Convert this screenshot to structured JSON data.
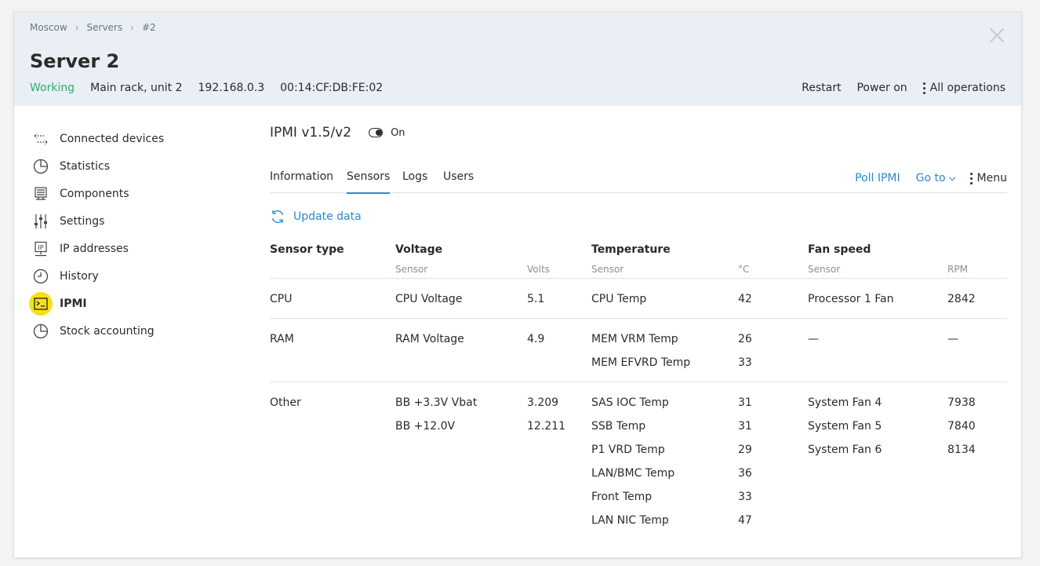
{
  "breadcrumb": [
    "Moscow",
    "Servers",
    "#2"
  ],
  "title": "Server 2",
  "meta": {
    "status": "Working",
    "location": "Main rack, unit 2",
    "ip": "192.168.0.3",
    "mac": "00:14:CF:DB:FE:02"
  },
  "header_actions": {
    "restart": "Restart",
    "power_on": "Power on",
    "all_operations": "All operations"
  },
  "sidebar": {
    "items": [
      {
        "label": "Connected devices",
        "icon": "connected-devices-icon"
      },
      {
        "label": "Statistics",
        "icon": "pie-chart-icon"
      },
      {
        "label": "Components",
        "icon": "components-icon"
      },
      {
        "label": "Settings",
        "icon": "sliders-icon"
      },
      {
        "label": "IP addresses",
        "icon": "ip-icon"
      },
      {
        "label": "History",
        "icon": "clock-icon"
      },
      {
        "label": "IPMI",
        "icon": "terminal-icon",
        "active": true
      },
      {
        "label": "Stock accounting",
        "icon": "pie-chart-icon"
      }
    ]
  },
  "ipmi": {
    "title": "IPMI v1.5/v2",
    "toggle_label": "On",
    "tabs": [
      "Information",
      "Sensors",
      "Logs",
      "Users"
    ],
    "active_tab": "Sensors",
    "poll": "Poll IPMI",
    "goto": "Go to",
    "menu": "Menu",
    "update": "Update data"
  },
  "table": {
    "headers": {
      "sensor_type": "Sensor type",
      "voltage": "Voltage",
      "temperature": "Temperature",
      "fan_speed": "Fan speed"
    },
    "subheaders": {
      "v_sensor": "Sensor",
      "v_unit": "Volts",
      "t_sensor": "Sensor",
      "t_unit": "°C",
      "f_sensor": "Sensor",
      "f_unit": "RPM"
    },
    "groups": {
      "cpu": {
        "type": "CPU",
        "voltage": [
          {
            "name": "CPU Voltage",
            "value": "5.1"
          }
        ],
        "temp": [
          {
            "name": "CPU Temp",
            "value": "42"
          }
        ],
        "fan": [
          {
            "name": "Processor 1 Fan",
            "value": "2842"
          }
        ]
      },
      "ram": {
        "type": "RAM",
        "voltage": [
          {
            "name": "RAM Voltage",
            "value": "4.9"
          }
        ],
        "temp": [
          {
            "name": "MEM VRM Temp",
            "value": "26"
          },
          {
            "name": "MEM EFVRD Temp",
            "value": "33"
          }
        ],
        "fan": [
          {
            "name": "—",
            "value": "—"
          }
        ]
      },
      "other": {
        "type": "Other",
        "voltage": [
          {
            "name": "BB +3.3V Vbat",
            "value": "3.209"
          },
          {
            "name": "BB +12.0V",
            "value": "12.211"
          }
        ],
        "temp": [
          {
            "name": "SAS IOC Temp",
            "value": "31"
          },
          {
            "name": "SSB Temp",
            "value": "31"
          },
          {
            "name": "P1 VRD Temp",
            "value": "29"
          },
          {
            "name": "LAN/BMC Temp",
            "value": "36"
          },
          {
            "name": "Front Temp",
            "value": "33"
          },
          {
            "name": "LAN NIC Temp",
            "value": "47"
          }
        ],
        "fan": [
          {
            "name": "System Fan 4",
            "value": "7938"
          },
          {
            "name": "System Fan 5",
            "value": "7840"
          },
          {
            "name": "System Fan 6",
            "value": "8134"
          }
        ]
      }
    }
  },
  "colors": {
    "accent": "#2a8acb",
    "status_ok": "#2fae66",
    "active_highlight": "#f7e017",
    "header_bg": "#e9eff5"
  }
}
